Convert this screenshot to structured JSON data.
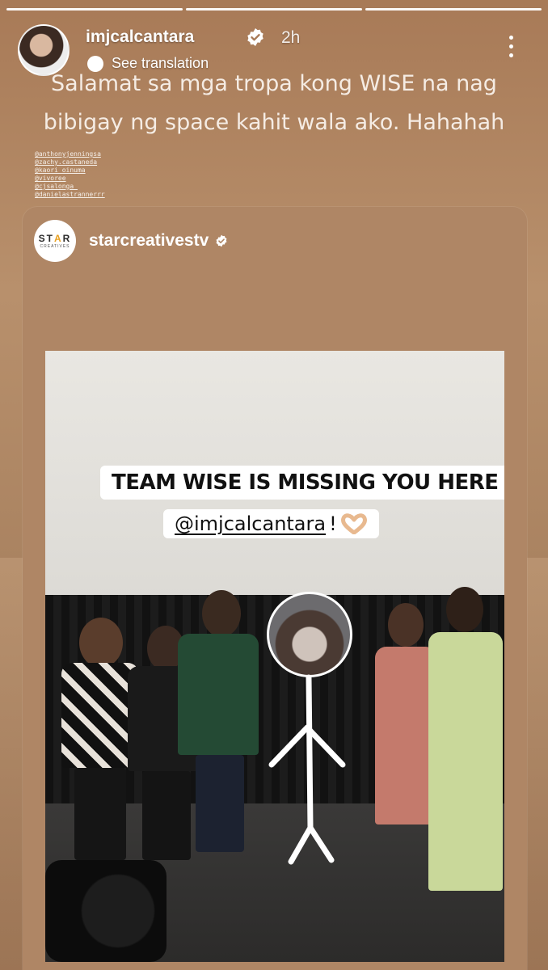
{
  "progress": {
    "segments": 3,
    "active": 3
  },
  "header": {
    "username": "imjcalcantara",
    "time": "2h",
    "see_translation": "See translation"
  },
  "caption": {
    "line1": "Salamat sa mga tropa kong WISE na nag",
    "line2": "bibigay ng space kahit wala ako. Hahahah"
  },
  "mentions": [
    "@anthonyjenningsa",
    "@zachy.castaneda",
    "@kaori_oinuma",
    "@vivoree",
    "@cjsalonga_",
    "@danielastrannerrr"
  ],
  "shared_post": {
    "account_name": "starcreativestv",
    "logo_text_line1_a": "ST",
    "logo_text_line1_b": "A",
    "logo_text_line1_c": "R",
    "logo_text_line2": "CREATIVES",
    "banner_line1": "TEAM WISE IS MISSING YOU HERE",
    "banner_mention": "@imjcalcantara",
    "banner_punct": "!"
  },
  "colors": {
    "background": "#a87a57",
    "verified": "#3897f0",
    "star_accent": "#e8a020"
  },
  "icons": [
    "verified-badge-icon",
    "more-options-icon",
    "translate-icon",
    "heart-hands-emoji"
  ]
}
